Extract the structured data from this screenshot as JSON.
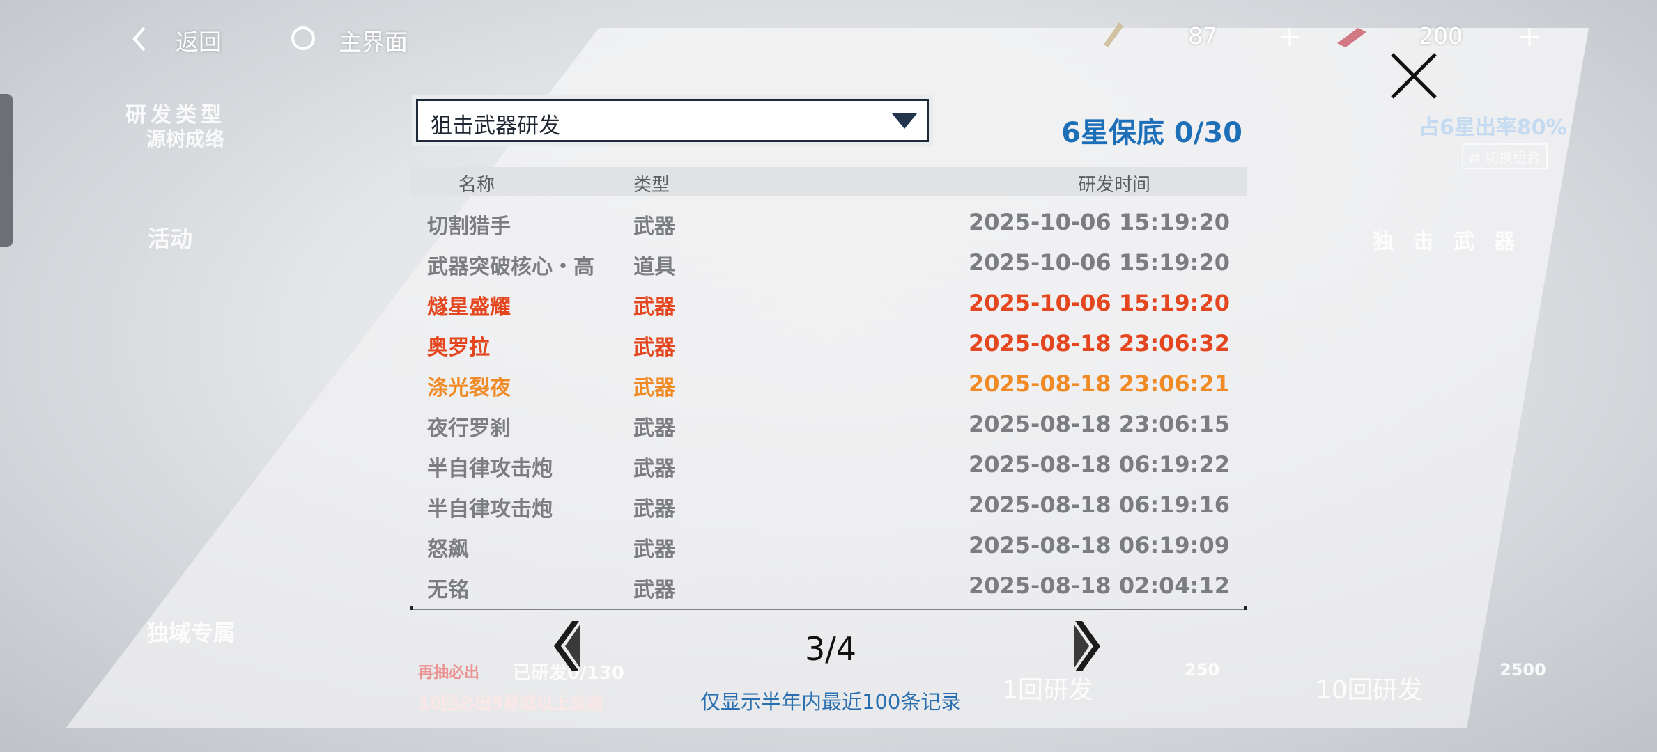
{
  "topbar": {
    "back_label": "返回",
    "home_label": "主界面",
    "currency_1_value": "87",
    "currency_2_value": "200"
  },
  "background": {
    "research_type_label": "研发类型",
    "left_item_1": "源树成络",
    "left_item_2": "活动",
    "left_item_3": "独域专属",
    "rate_label": "占6星出率80%",
    "switch_label": "切换组合",
    "weapon_title": "独击武器",
    "pity_note_tag": "再抽必出",
    "pity_note_count": "已研发0/130",
    "pity_note_bottom": "10回必出5星或以上武器",
    "one_pull_label": "1回研发",
    "one_pull_cost": "250",
    "ten_pull_label": "10回研发",
    "ten_pull_cost": "2500"
  },
  "dialog": {
    "dropdown_value": "狙击武器研发",
    "pity_text": "6星保底 0/30",
    "columns": {
      "name": "名称",
      "type": "类型",
      "time": "研发时间"
    },
    "rows": [
      {
        "name": "切割猎手",
        "type": "武器",
        "time": "2025-10-06 15:19:20",
        "rarity": "normal"
      },
      {
        "name": "武器突破核心・高",
        "type": "道具",
        "time": "2025-10-06 15:19:20",
        "rarity": "normal"
      },
      {
        "name": "燧星盛耀",
        "type": "武器",
        "time": "2025-10-06 15:19:20",
        "rarity": "red"
      },
      {
        "name": "奥罗拉",
        "type": "武器",
        "time": "2025-08-18 23:06:32",
        "rarity": "red"
      },
      {
        "name": "涤光裂夜",
        "type": "武器",
        "time": "2025-08-18 23:06:21",
        "rarity": "orange"
      },
      {
        "name": "夜行罗刹",
        "type": "武器",
        "time": "2025-08-18 23:06:15",
        "rarity": "normal"
      },
      {
        "name": "半自律攻击炮",
        "type": "武器",
        "time": "2025-08-18 06:19:22",
        "rarity": "normal"
      },
      {
        "name": "半自律攻击炮",
        "type": "武器",
        "time": "2025-08-18 06:19:16",
        "rarity": "normal"
      },
      {
        "name": "怒飙",
        "type": "武器",
        "time": "2025-08-18 06:19:09",
        "rarity": "normal"
      },
      {
        "name": "无铭",
        "type": "武器",
        "time": "2025-08-18 02:04:12",
        "rarity": "normal"
      }
    ],
    "page": "3/4",
    "note": "仅显示半年内最近100条记录"
  },
  "colors": {
    "normal": "#7b7d80",
    "red": "#e4471f",
    "orange": "#f08a24",
    "accent_blue": "#1d6fb8"
  }
}
